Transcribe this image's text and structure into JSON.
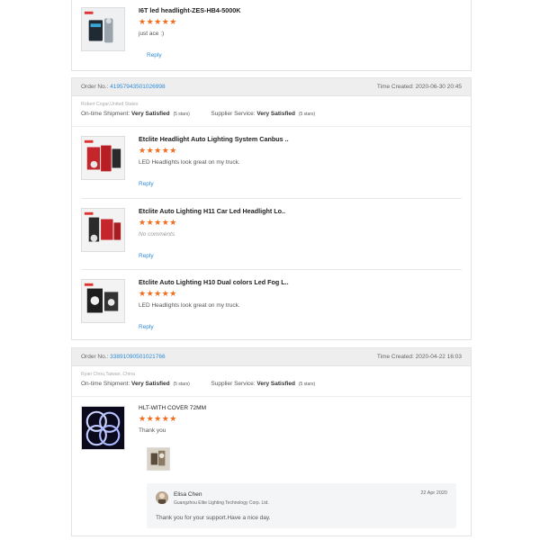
{
  "review_top": {
    "item": {
      "title": "I6T led headlight-ZES-HB4-5000K",
      "stars": "★★★★★",
      "comment": "just ace :)",
      "reply": "Reply"
    }
  },
  "order2": {
    "order_label": "Order No.:",
    "order_no": "41957943501026998",
    "time_label": "Time Created:",
    "time": "2020-06-30 20:45",
    "buyer": "Robert Cogar,United States",
    "shipment_label": "On-time Shipment:",
    "shipment_value": "Very Satisfied",
    "shipment_stars": "(5 stars)",
    "supplier_label": "Supplier Service:",
    "supplier_value": "Very Satisfied",
    "supplier_stars": "(5 stars)",
    "items": [
      {
        "title": "Etclite Headlight Auto Lighting System Canbus ..",
        "stars": "★★★★★",
        "comment": "LED Headlights look great on my truck.",
        "reply": "Reply"
      },
      {
        "title": "Etclite Auto Lighting H11 Car Led Headlight Lo..",
        "stars": "★★★★★",
        "comment": "No comments",
        "reply": "Reply"
      },
      {
        "title": "Etclite Auto Lighting H10 Dual colors Led Fog L..",
        "stars": "★★★★★",
        "comment": "LED Headlights look great on my truck.",
        "reply": "Reply"
      }
    ]
  },
  "order3": {
    "order_label": "Order No.:",
    "order_no": "33891090501021766",
    "time_label": "Time Created:",
    "time": "2020-04-22 16:03",
    "buyer": "Ryan Chou,Taiwan, China",
    "shipment_label": "On-time Shipment:",
    "shipment_value": "Very Satisfied",
    "shipment_stars": "(5 stars)",
    "supplier_label": "Supplier Service:",
    "supplier_value": "Very Satisfied",
    "supplier_stars": "(5 stars)",
    "item": {
      "title": "HLT-WITH COVER 72MM",
      "stars": "★★★★★",
      "comment": "Thank you"
    },
    "seller_reply": {
      "name": "Elisa Chen",
      "company": "Guangzhou Elite Lighting Technology Corp. Ltd.",
      "date": "22 Apr 2020",
      "text": "Thank you for your support.Have a nice day."
    }
  },
  "colors": {
    "accent": "#2f8bd9",
    "star": "#f26b1d",
    "header_bg": "#eeeeee"
  }
}
